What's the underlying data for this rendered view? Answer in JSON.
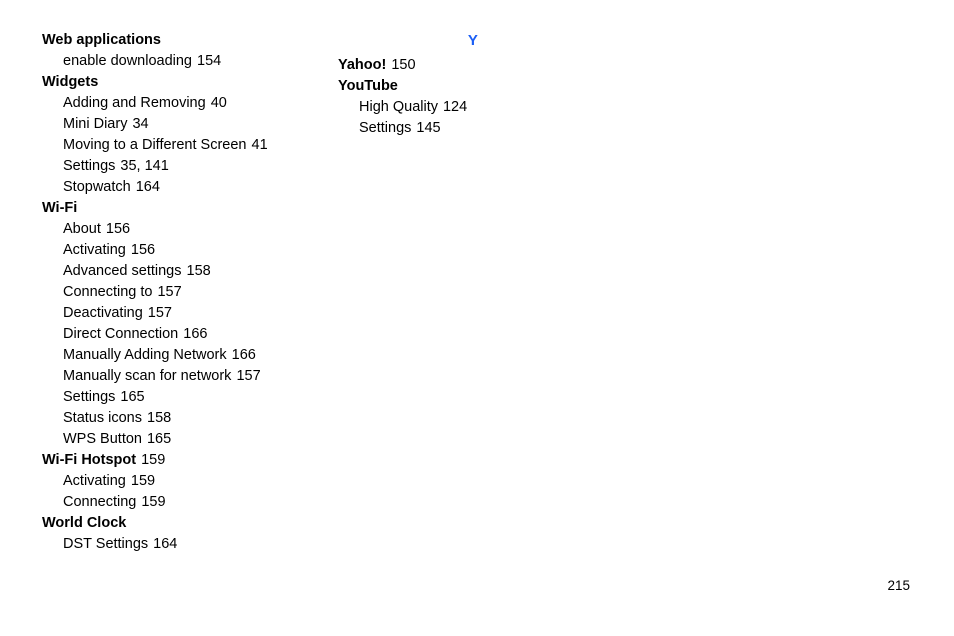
{
  "document": {
    "type": "book-index",
    "page_number": "215",
    "accent_color": "#1b5ef5"
  },
  "columns": [
    {
      "name": "left",
      "section_letter": null,
      "entries": [
        {
          "term": "Web applications",
          "pages": "",
          "level": 0
        },
        {
          "term": "enable downloading",
          "pages": "154",
          "level": 1
        },
        {
          "term": "Widgets",
          "pages": "",
          "level": 0
        },
        {
          "term": "Adding and Removing",
          "pages": "40",
          "level": 1
        },
        {
          "term": "Mini Diary",
          "pages": "34",
          "level": 1
        },
        {
          "term": "Moving to a Different Screen",
          "pages": "41",
          "level": 1
        },
        {
          "term": "Settings",
          "pages": "35, 141",
          "level": 1
        },
        {
          "term": "Stopwatch",
          "pages": "164",
          "level": 1
        },
        {
          "term": "Wi-Fi",
          "pages": "",
          "level": 0
        },
        {
          "term": "About",
          "pages": "156",
          "level": 1
        },
        {
          "term": "Activating",
          "pages": "156",
          "level": 1
        },
        {
          "term": "Advanced settings",
          "pages": "158",
          "level": 1
        },
        {
          "term": "Connecting to",
          "pages": "157",
          "level": 1
        },
        {
          "term": "Deactivating",
          "pages": "157",
          "level": 1
        },
        {
          "term": "Direct Connection",
          "pages": "166",
          "level": 1
        },
        {
          "term": "Manually Adding Network",
          "pages": "166",
          "level": 1
        },
        {
          "term": "Manually scan for network",
          "pages": "157",
          "level": 1
        },
        {
          "term": "Settings",
          "pages": "165",
          "level": 1
        },
        {
          "term": "Status icons",
          "pages": "158",
          "level": 1
        },
        {
          "term": "WPS Button",
          "pages": "165",
          "level": 1
        },
        {
          "term": "Wi-Fi Hotspot",
          "pages": "159",
          "level": 0
        },
        {
          "term": "Activating",
          "pages": "159",
          "level": 1
        },
        {
          "term": "Connecting",
          "pages": "159",
          "level": 1
        },
        {
          "term": "World Clock",
          "pages": "",
          "level": 0
        },
        {
          "term": "DST Settings",
          "pages": "164",
          "level": 1
        }
      ]
    },
    {
      "name": "right",
      "section_letter": "Y",
      "entries": [
        {
          "term": "Yahoo!",
          "pages": "150",
          "level": 0
        },
        {
          "term": "YouTube",
          "pages": "",
          "level": 0
        },
        {
          "term": "High Quality",
          "pages": "124",
          "level": 1
        },
        {
          "term": "Settings",
          "pages": "145",
          "level": 1
        }
      ]
    }
  ]
}
